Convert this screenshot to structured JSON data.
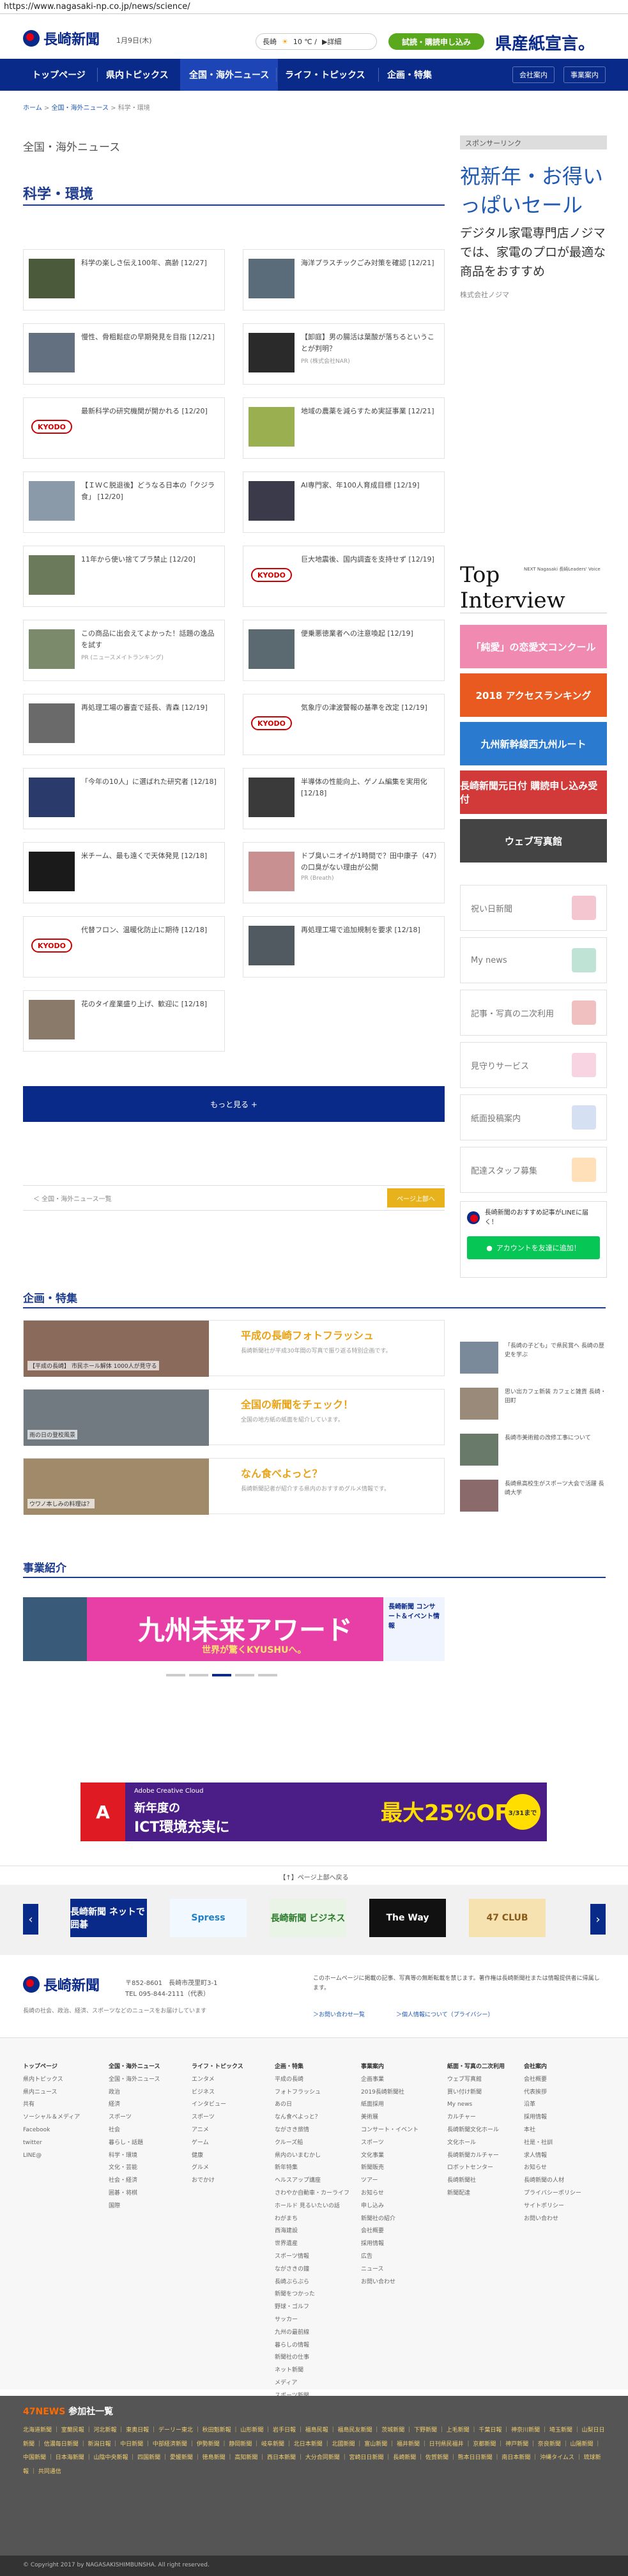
{
  "browser": {
    "url": "https://www.nagasaki-np.co.jp/news/science/"
  },
  "header": {
    "logo": "長崎新聞",
    "date": "1月9日(木)",
    "weather": {
      "city": "長崎",
      "temp": "10 ℃ /",
      "detail": "▶詳細"
    },
    "trial_button": "試読・購読申し込み",
    "banner": "県産紙宣言。"
  },
  "nav": {
    "items": [
      "トップページ",
      "県内トピックス",
      "全国・海外ニュース",
      "ライフ・トピックス",
      "企画・特集"
    ],
    "small": [
      "会社案内",
      "事業案内"
    ]
  },
  "breadcrumb": {
    "home": "ホーム",
    "section": "全国・海外ニュース",
    "current": "科学・環境"
  },
  "main": {
    "section_label": "全国・海外ニュース",
    "page_title": "科学・環境",
    "articles": [
      {
        "text": "科学の楽しさ伝え100年、高齢 [12/27]",
        "sub": "",
        "img": "#4a5a3a",
        "kyodo": false
      },
      {
        "text": "海洋プラスチックごみ対策を確認 [12/21]",
        "sub": "",
        "img": "#5a6b7a",
        "kyodo": false
      },
      {
        "text": "慢性、骨粗鬆症の早期発見を目指 [12/21]",
        "sub": "",
        "img": "#627080",
        "kyodo": false
      },
      {
        "text": "【卸庭】男の腸活は葉酸が落ちるということが判明？",
        "sub": "PR (株式会社NAR)",
        "img": "#2a2a2a",
        "kyodo": false
      },
      {
        "text": "最新科学の研究機関が開かれる [12/20]",
        "sub": "",
        "img": "",
        "kyodo": true
      },
      {
        "text": "地域の農薬を減らすため実証事業 [12/21]",
        "sub": "",
        "img": "#9ab050",
        "kyodo": false
      },
      {
        "text": "【ＩＷＣ脱退後】どうなる日本の「クジラ食」 [12/20]",
        "sub": "",
        "img": "#8a9aa8",
        "kyodo": false
      },
      {
        "text": "AI専門家、年100人育成目標 [12/19]",
        "sub": "",
        "img": "#3a3a4a",
        "kyodo": false
      },
      {
        "text": "11年から使い捨てプラ禁止 [12/20]",
        "sub": "",
        "img": "#6a7a5a",
        "kyodo": false
      },
      {
        "text": "巨大地震後、国内調査を支持せず [12/19]",
        "sub": "",
        "img": "",
        "kyodo": true
      },
      {
        "text": "この商品に出会えてよかった！話題の逸品を試す",
        "sub": "PR (ニュースメイトランキング)",
        "img": "#7a8a6a",
        "kyodo": false
      },
      {
        "text": "便乗悪徳業者への注意喚起 [12/19]",
        "sub": "",
        "img": "#5a6a70",
        "kyodo": false
      },
      {
        "text": "再処理工場の審査で延長、青森 [12/19]",
        "sub": "",
        "img": "#6a6a6a",
        "kyodo": false
      },
      {
        "text": "気象庁の津波警報の基準を改定 [12/19]",
        "sub": "",
        "img": "",
        "kyodo": true
      },
      {
        "text": "「今年の10人」に選ばれた研究者 [12/18]",
        "sub": "",
        "img": "#2a3a6a",
        "kyodo": false
      },
      {
        "text": "半導体の性能向上、ゲノム編集を実用化 [12/18]",
        "sub": "",
        "img": "#3a3a3a",
        "kyodo": false
      },
      {
        "text": "米チーム、最も遠くで天体発見 [12/18]",
        "sub": "",
        "img": "#1a1a1a",
        "kyodo": false
      },
      {
        "text": "ドブ臭いニオイが1時間で？田中康子（47）の口臭がない理由が公開",
        "sub": "PR (Breath)",
        "img": "#c89090",
        "kyodo": false
      },
      {
        "text": "代替フロン、温暖化防止に期待 [12/18]",
        "sub": "",
        "img": "",
        "kyodo": true
      },
      {
        "text": "再処理工場で追加規制を要求 [12/18]",
        "sub": "",
        "img": "#505a60",
        "kyodo": false
      },
      {
        "text": "花のタイ産業盛り上げ、歓迎に [12/18]",
        "sub": "",
        "img": "#8a7a6a",
        "kyodo": false
      }
    ],
    "more_button": "もっと見る +",
    "pager_back": "＜ 全国・海外ニュース一覧",
    "pager_top": "ページ上部へ"
  },
  "sidebar": {
    "sponsor_head": "スポンサーリンク",
    "ad_title": "祝新年・お得いっぱいセール",
    "ad_body": "デジタル家電専門店ノジマでは、家電のプロが最適な商品をおすすめ",
    "ad_brand": "株式会社ノジマ",
    "interview": {
      "title": "Top Interview",
      "small": "NEXT Nagasaki 長崎Leaders' Voice"
    },
    "banners": [
      {
        "label": "「純愛」の恋愛文コンクール",
        "color": "#f08ab0"
      },
      {
        "label": "2018 アクセスランキング",
        "color": "#e85a20"
      },
      {
        "label": "九州新幹線西九州ルート",
        "color": "#2a7ad0"
      },
      {
        "label": "長崎新聞元日付 購読申し込み受付",
        "color": "#d23a3a"
      },
      {
        "label": "ウェブ写真館",
        "color": "#444444"
      }
    ],
    "links": [
      {
        "label": "祝い日新聞",
        "color": "#f4c6d0"
      },
      {
        "label": "My news",
        "color": "#bfe3d4"
      },
      {
        "label": "記事・写真の二次利用",
        "color": "#f0c0c0"
      },
      {
        "label": "見守りサービス",
        "color": "#f8d3e2"
      },
      {
        "label": "紙面投稿案内",
        "color": "#d5e0f2"
      },
      {
        "label": "配達スタッフ募集",
        "color": "#ffe0b8"
      }
    ],
    "line": {
      "text": "長崎新聞のおすすめ記事がLINEに届く！",
      "button": "アカウントを友達に追加！"
    }
  },
  "features": {
    "title": "企画・特集",
    "rows": [
      {
        "title": "平成の長崎フォトフラッシュ",
        "desc": "長崎新聞社が平成30年間の写真で振り返る特別企画です。",
        "caption": "【平成の長崎】 市民ホール解体 1000人が見守る",
        "img": "#8a6a5a"
      },
      {
        "title": "全国の新聞をチェック！",
        "desc": "全国の地方紙の紙面を紹介しています。",
        "caption": "雨の日の登校風景",
        "img": "#707a80"
      },
      {
        "title": "なん食べよっと？",
        "desc": "長崎新聞記者が紹介する県内のおすすめグルメ情報です。",
        "caption": "ウワノ本しみの料理は？",
        "img": "#a08a6a"
      }
    ],
    "mini": [
      {
        "text": "「長崎の子ども」で県民賞へ 長崎の歴史を学ぶ",
        "img": "#7a8a9a"
      },
      {
        "text": "思い出カフェ新装 カフェと雑貨 長崎・田町",
        "img": "#9a8a7a"
      },
      {
        "text": "長崎市美術館の改修工事について",
        "img": "#6a7a6a"
      },
      {
        "text": "長崎県高校生がスポーツ大会で活躍 長崎大学",
        "img": "#8a6a6a"
      }
    ]
  },
  "events": {
    "title": "事業紹介",
    "award_title": "九州未来アワード",
    "award_sub": "世界が驚くKYUSHUへ。",
    "side": "長崎新聞 コンサート＆イベント情報"
  },
  "ad": {
    "brand": "Adobe Creative Cloud",
    "line1": "新年度の",
    "line2": "ICT環境充実に",
    "offer": "最大25%OFF",
    "badge": "3/31まで"
  },
  "carousel": {
    "band": "【↑】ページ上部へ戻る",
    "items": [
      "長崎新聞 ネットで囲碁",
      "Spress",
      "長崎新聞 ビジネス",
      "The Way",
      "47 CLUB"
    ]
  },
  "footer": {
    "logo": "長崎新聞",
    "address": "〒852-8601　長崎市茂里町3-1",
    "tel": "TEL 095-844-2111（代表）",
    "note": "長崎の社会、政治、経済、スポーツなどのニュースをお届けしています",
    "notice": "このホームページに掲載の記事、写真等の無断転載を禁じます。著作権は長崎新聞社または情報提供者に帰属します。",
    "link1": "＞お問い合わせ一覧",
    "link2": "＞個人情報について（プライバシー）",
    "columns": [
      {
        "head": "トップページ",
        "items": [
          "県内トピックス",
          "県内ニュース",
          "共有",
          "ソーシャル＆メディア",
          "Facebook",
          "twitter",
          "LINE@"
        ]
      },
      {
        "head": "全国・海外ニュース",
        "items": [
          "全国・海外ニュース",
          "政治",
          "経済",
          "スポーツ",
          "社会",
          "暮らし・話題",
          "科学・環境",
          "文化・芸能",
          "社会・経済",
          "囲碁・将棋",
          "国際"
        ]
      },
      {
        "head": "ライフ・トピックス",
        "items": [
          "エンタメ",
          "ビジネス",
          "インタビュー",
          "スポーツ",
          "アニメ",
          "ゲーム",
          "健康",
          "グルメ",
          "おでかけ"
        ]
      },
      {
        "head": "企画・特集",
        "items": [
          "平成の長崎",
          "フォトフラッシュ",
          "あの日",
          "なん食べよっと？",
          "ながさき旅情",
          "クルーズ船",
          "県内のいまむかし",
          "新年特集",
          "ヘルスアップ講座",
          "さわやか自動車・カーライフ",
          "ホールド 見るいたいの話",
          "わがまち",
          "西海建設",
          "世界遺産",
          "スポーツ情報",
          "ながさきの鐘",
          "長崎ぶらぶら",
          "新聞をつかった",
          "野球・ゴルフ",
          "サッカー",
          "九州の最前線",
          "暮らしの情報",
          "新聞社の仕事",
          "ネット新聞",
          "メディア",
          "スポーツ新聞",
          "最新ランキング"
        ]
      },
      {
        "head": "事業案内",
        "items": [
          "企画事業",
          "2019長崎新聞社",
          "紙面採用",
          "美術展",
          "コンサート・イベント",
          "スポーツ",
          "文化事業",
          "新聞販売",
          "ツアー",
          "お知らせ",
          "申し込み",
          "新聞社の紹介",
          "会社概要",
          "採用情報",
          "広告",
          "ニュース",
          "お問い合わせ"
        ]
      },
      {
        "head": "紙面・写真の二次利用",
        "items": [
          "ウェブ写真館",
          "買い付け新聞",
          "My news",
          "カルチャー",
          "長崎新聞文化ホール",
          "文化ホール",
          "長崎新聞カルチャー",
          "ロボットセンター",
          "長崎新聞社",
          "新聞配達"
        ]
      },
      {
        "head": "会社案内",
        "items": [
          "会社概要",
          "代表挨拶",
          "沿革",
          "採用情報",
          "本社",
          "社是・社訓",
          "求人情報",
          "お知らせ",
          "長崎新聞の人材",
          "プライバシーポリシー",
          "サイトポリシー",
          "お問い合わせ"
        ]
      }
    ]
  },
  "news47": {
    "title": "47NEWS",
    "title_suffix": "参加社一覧",
    "list": "北海道新聞 ｜ 室蘭民報 ｜ 河北新報 ｜ 東奥日報 ｜ デーリー東北 ｜ 秋田魁新報 ｜ 山形新聞 ｜ 岩手日報 ｜ 福島民報 ｜ 福島民友新聞 ｜ 茨城新聞 ｜ 下野新聞 ｜ 上毛新聞 ｜ 千葉日報 ｜ 神奈川新聞 ｜ 埼玉新聞 ｜ 山梨日日新聞 ｜ 信濃毎日新聞 ｜ 新潟日報 ｜ 中日新聞 ｜ 中部経済新聞 ｜ 伊勢新聞 ｜ 静岡新聞 ｜ 岐阜新聞 ｜ 北日本新聞 ｜ 北國新聞 ｜ 富山新聞 ｜ 福井新聞 ｜ 日刊県民福井 ｜ 京都新聞 ｜ 神戸新聞 ｜ 奈良新聞 ｜ 山陽新聞 ｜ 中国新聞 ｜ 日本海新聞 ｜ 山陰中央新報 ｜ 四国新聞 ｜ 愛媛新聞 ｜ 徳島新聞 ｜ 高知新聞 ｜ 西日本新聞 ｜ 大分合同新聞 ｜ 宮崎日日新聞 ｜ 長崎新聞 ｜ 佐賀新聞 ｜ 熊本日日新聞 ｜ 南日本新聞 ｜ 沖縄タイムス ｜ 琉球新報 ｜ 共同通信"
  },
  "copyright": "© Copyright 2017 by NAGASAKISHIMBUNSHA. All right reserved."
}
